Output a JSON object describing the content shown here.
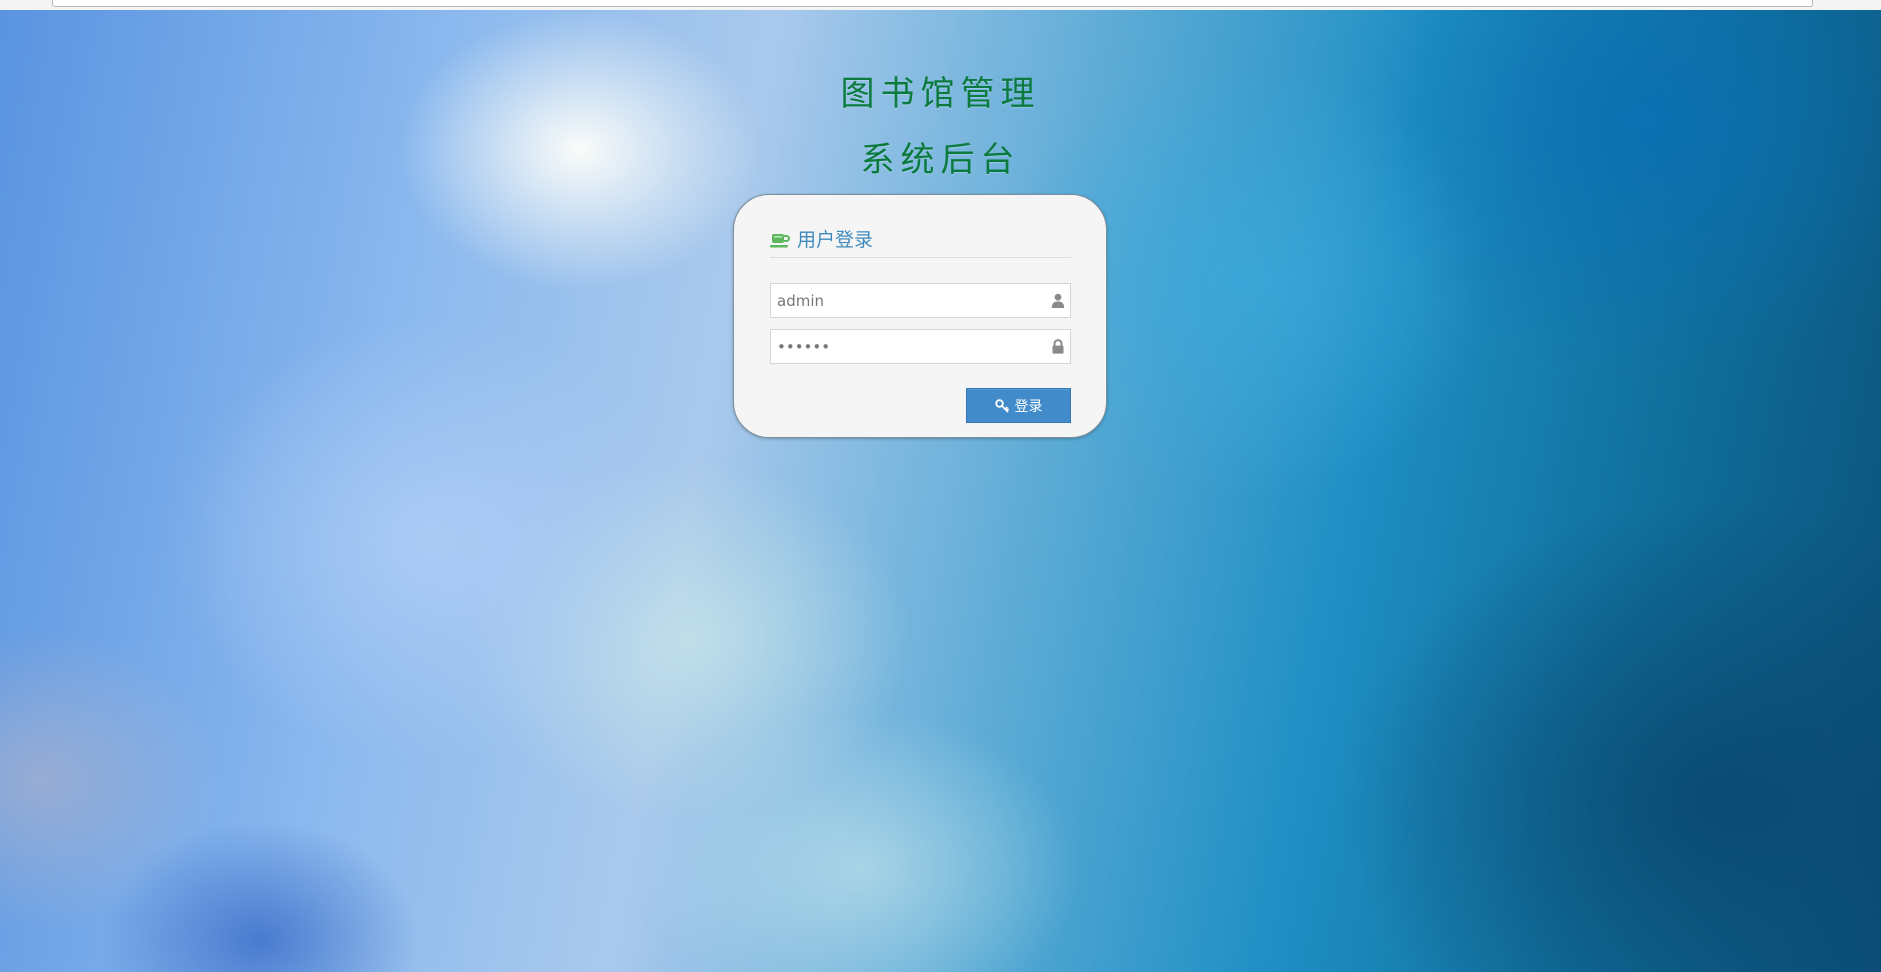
{
  "page": {
    "heading_line1": "图书馆管理",
    "heading_line2": "系统后台",
    "heading_color": "#0b7a3e"
  },
  "login": {
    "title": "用户登录",
    "title_icon": "coffee-cup-icon",
    "accent_color": "#3f8bbd",
    "username": {
      "value": "admin",
      "icon": "user-icon"
    },
    "password": {
      "value": "123456",
      "icon": "lock-icon"
    },
    "submit": {
      "label": "登录",
      "icon": "key-icon",
      "color": "#428bca"
    }
  }
}
